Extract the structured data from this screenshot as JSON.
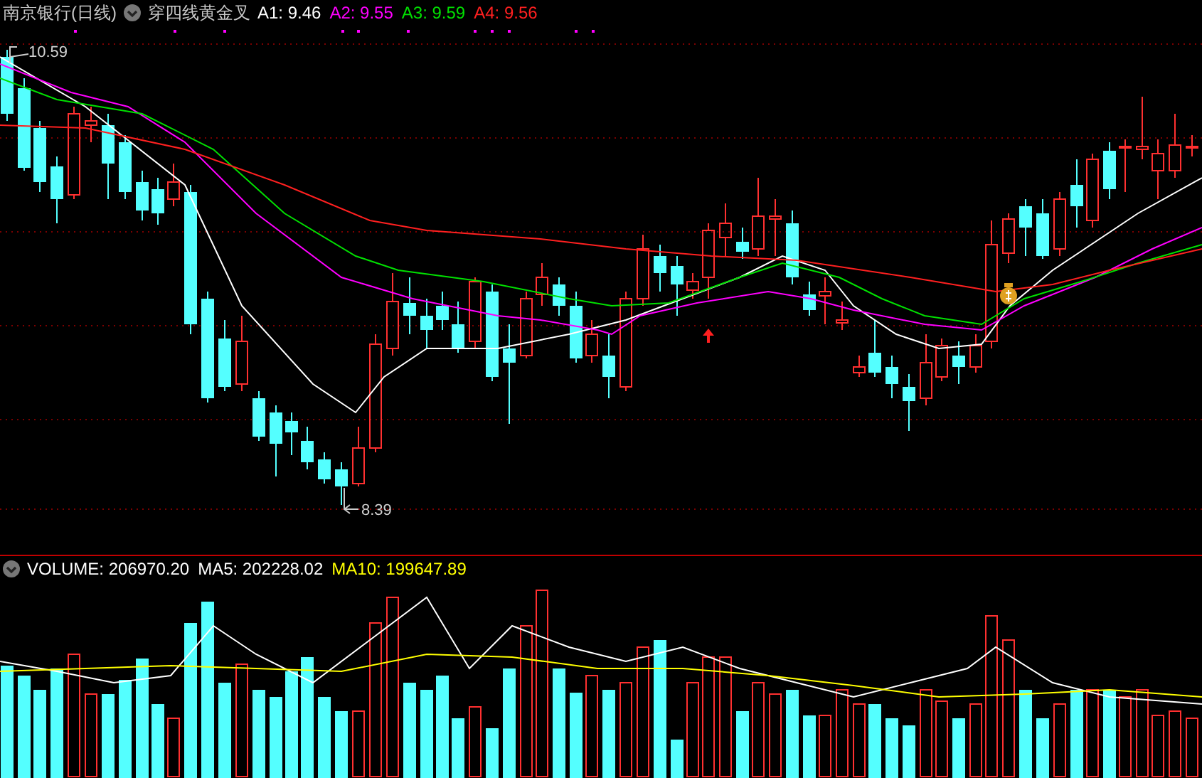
{
  "header": {
    "stock_name": "南京银行(日线)",
    "indicator": "穿四线黄金叉",
    "legend": [
      {
        "label": "A1:",
        "value": "9.46",
        "color": "#ffffff"
      },
      {
        "label": "A2:",
        "value": "9.55",
        "color": "#ff00ff"
      },
      {
        "label": "A3:",
        "value": "9.59",
        "color": "#00e000"
      },
      {
        "label": "A4:",
        "value": "9.56",
        "color": "#ff2020"
      }
    ]
  },
  "price_markers": {
    "high": "10.59",
    "low": "8.39"
  },
  "volume_header": {
    "legend": [
      {
        "label": "VOLUME:",
        "value": "206970.20",
        "color": "#ffffff"
      },
      {
        "label": "MA5:",
        "value": "202228.02",
        "color": "#ffffff"
      },
      {
        "label": "MA10:",
        "value": "199647.89",
        "color": "#ffff00"
      }
    ]
  }
}
